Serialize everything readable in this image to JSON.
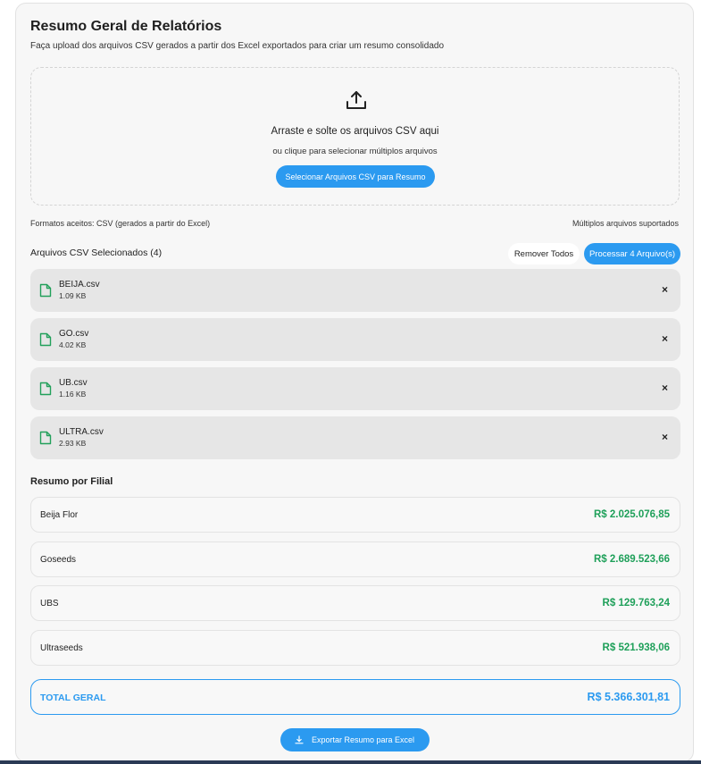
{
  "header": {
    "title": "Resumo Geral de Relatórios",
    "subtitle": "Faça upload dos arquivos CSV gerados a partir dos Excel exportados para criar um resumo consolidado"
  },
  "dropzone": {
    "main_text": "Arraste e solte os arquivos CSV aqui",
    "sub_text": "ou clique para selecionar múltiplos arquivos",
    "button_label": "Selecionar Arquivos CSV para Resumo",
    "icon": "upload-icon"
  },
  "info": {
    "formats": "Formatos aceitos: CSV (gerados a partir do Excel)",
    "multiple": "Múltiplos arquivos suportados"
  },
  "files": {
    "title": "Arquivos CSV Selecionados (4)",
    "remove_all_label": "Remover Todos",
    "process_label": "Processar 4 Arquivo(s)",
    "items": [
      {
        "name": "BEIJA.csv",
        "size": "1.09 KB"
      },
      {
        "name": "GO.csv",
        "size": "4.02 KB"
      },
      {
        "name": "UB.csv",
        "size": "1.16 KB"
      },
      {
        "name": "ULTRA.csv",
        "size": "2.93 KB"
      }
    ],
    "close_glyph": "×"
  },
  "summary": {
    "title": "Resumo por Filial",
    "branches": [
      {
        "name": "Beija Flor",
        "value": "R$ 2.025.076,85"
      },
      {
        "name": "Goseeds",
        "value": "R$ 2.689.523,66"
      },
      {
        "name": "UBS",
        "value": "R$ 129.763,24"
      },
      {
        "name": "Ultraseeds",
        "value": "R$ 521.938,06"
      }
    ],
    "total_label": "TOTAL GERAL",
    "total_value": "R$ 5.366.301,81"
  },
  "export": {
    "label": "Exportar Resumo para Excel"
  },
  "colors": {
    "accent": "#2b9af0",
    "positive": "#1fa05a",
    "file_icon": "#22a05a"
  }
}
